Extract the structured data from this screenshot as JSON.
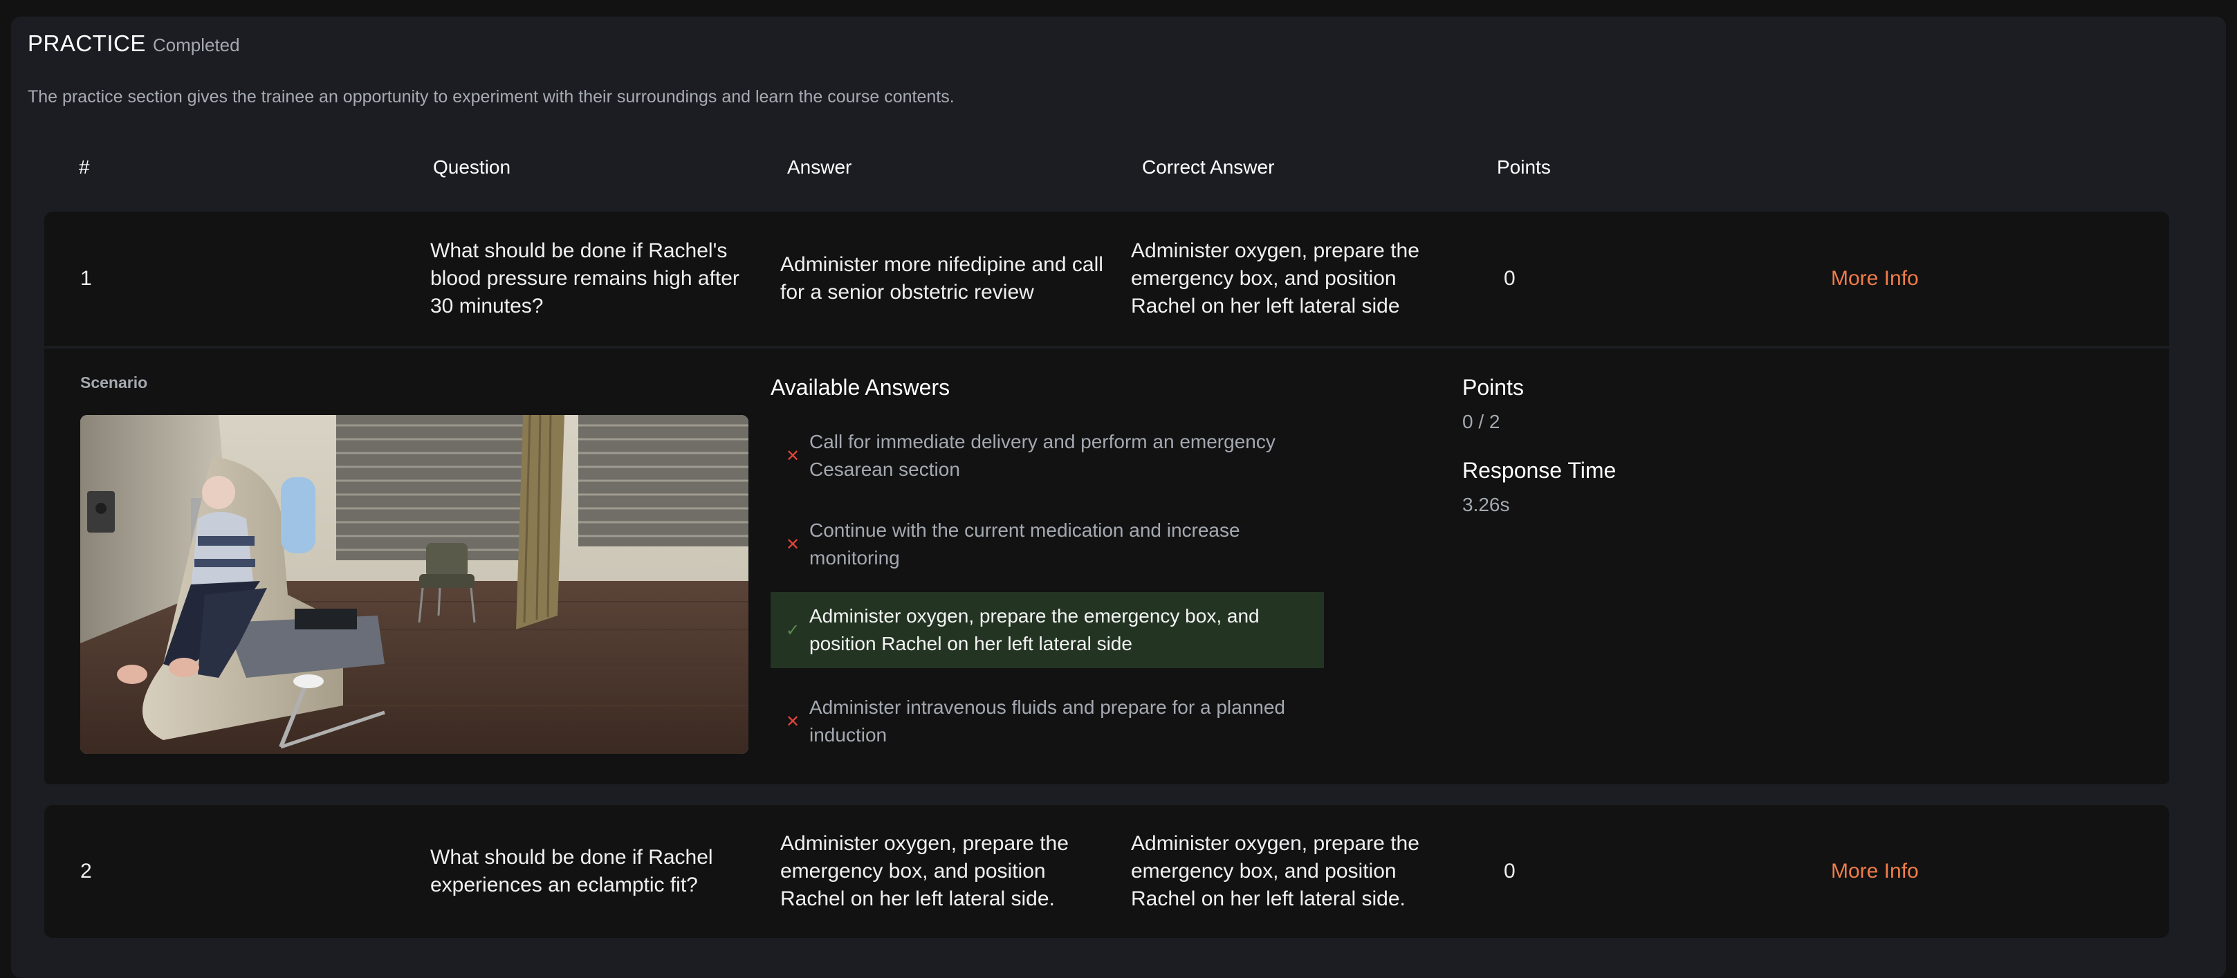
{
  "section": {
    "title": "PRACTICE",
    "status": "Completed",
    "description": "The practice section gives the trainee an opportunity to experiment with their surroundings and learn the course contents."
  },
  "table": {
    "headers": [
      "#",
      "Question",
      "Answer",
      "Correct Answer",
      "Points"
    ],
    "rows": [
      {
        "num": "1",
        "question": "What should be done if Rachel's blood pressure remains high after 30 minutes?",
        "answer": "Administer more nifedipine and call for a senior obstetric review",
        "correct": "Administer oxygen, prepare the emergency box, and position Rachel on her left lateral side",
        "points": "0",
        "more": "More Info"
      },
      {
        "num": "2",
        "question": "What should be done if Rachel experiences an eclamptic fit?",
        "answer": "Administer oxygen, prepare the emergency box, and position Rachel on her left lateral side.",
        "correct": "Administer oxygen, prepare the emergency box, and position Rachel on her left lateral side.",
        "points": "0",
        "more": "More Info"
      }
    ]
  },
  "detail": {
    "scenario_label": "Scenario",
    "available_title": "Available Answers",
    "answers": [
      {
        "text": "Call for immediate delivery and perform an emergency Cesarean section",
        "correct": false,
        "icon": "cross-icon"
      },
      {
        "text": "Continue with the current medication and increase monitoring",
        "correct": false,
        "icon": "cross-icon"
      },
      {
        "text": "Administer oxygen, prepare the emergency box, and position Rachel on her left lateral side",
        "correct": true,
        "icon": "check-icon"
      },
      {
        "text": "Administer intravenous fluids and prepare for a planned induction",
        "correct": false,
        "icon": "cross-icon"
      }
    ],
    "points_label": "Points",
    "points_value": "0 / 2",
    "response_label": "Response Time",
    "response_value": "3.26s"
  },
  "colors": {
    "accent": "#f07c4a",
    "correct_bg": "#233423",
    "wrong": "#e0443a",
    "panel": "#1b1d22",
    "row": "#121212"
  }
}
